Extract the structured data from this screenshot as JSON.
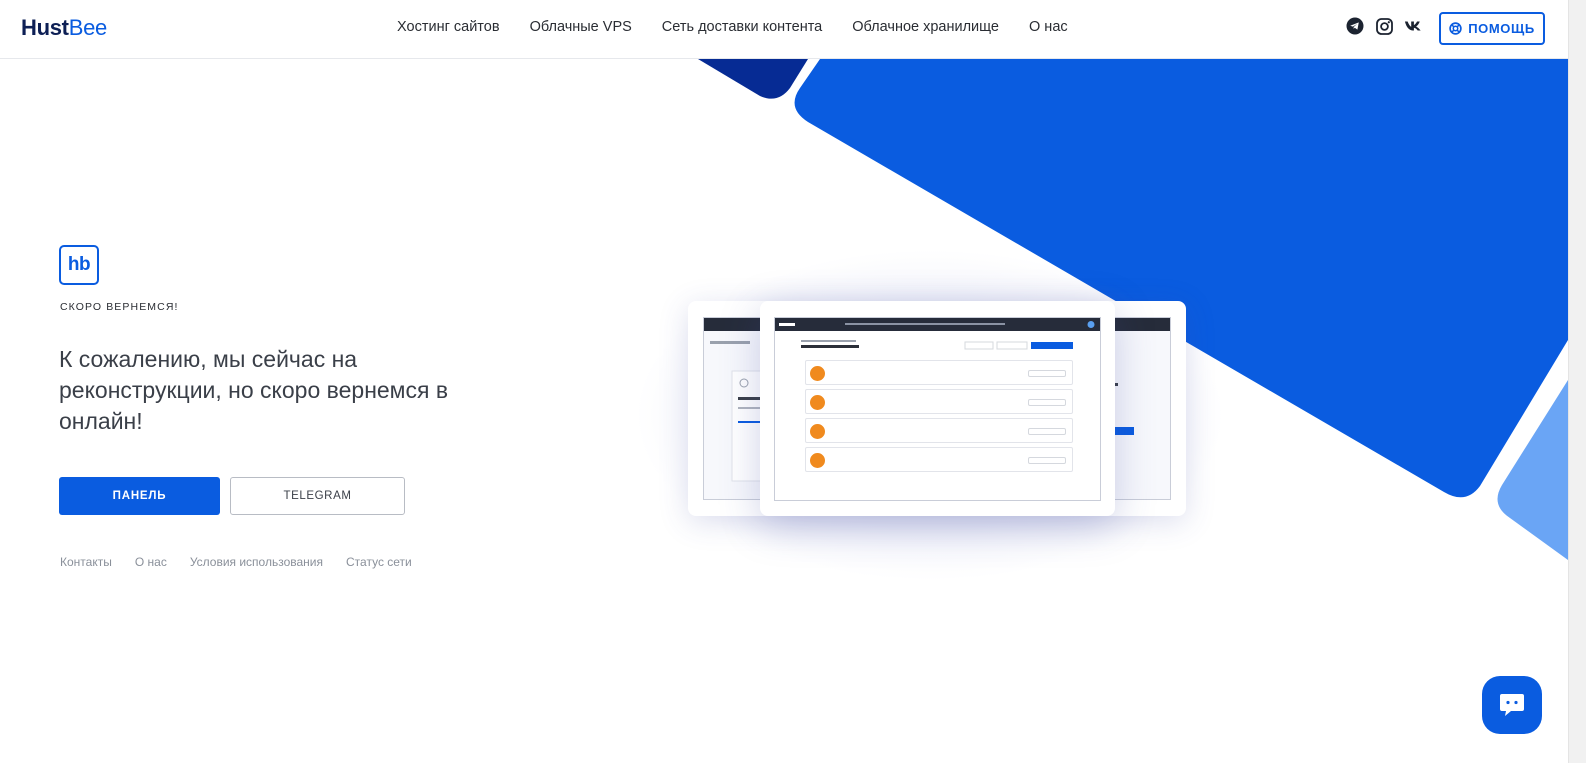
{
  "header": {
    "logo_part1": "Hust",
    "logo_part2": "Bee",
    "nav": [
      "Хостинг сайтов",
      "Облачные VPS",
      "Сеть доставки контента",
      "Облачное хранилище",
      "О нас"
    ],
    "socials": [
      "telegram-icon",
      "instagram-icon",
      "vk-icon"
    ],
    "help_label": "ПОМОЩЬ"
  },
  "hero": {
    "badge": "hb",
    "kicker": "СКОРО ВЕРНЕМСЯ!",
    "headline": "К сожалению, мы сейчас на реконструкции, но скоро вернемся в онлайн!",
    "primary_button": "ПАНЕЛЬ",
    "secondary_button": "TELEGRAM"
  },
  "footer": {
    "links": [
      "Контакты",
      "О нас",
      "Условия использования",
      "Статус сети"
    ]
  },
  "colors": {
    "accent": "#0a5ce0",
    "dark_blue": "#062b94",
    "light_blue": "#6aa5f5"
  }
}
